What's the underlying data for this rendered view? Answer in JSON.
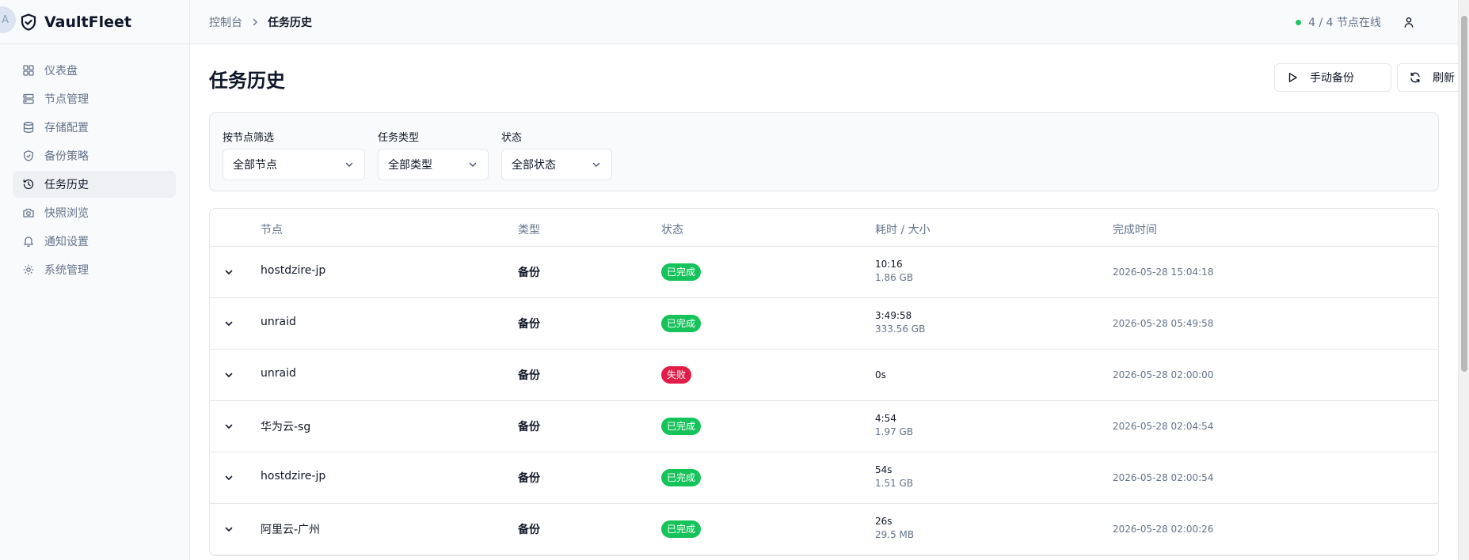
{
  "brand": {
    "avatar_letter": "A",
    "name": "VaultFleet"
  },
  "sidebar": {
    "items": [
      {
        "label": "仪表盘",
        "icon": "dashboard-icon",
        "active": false
      },
      {
        "label": "节点管理",
        "icon": "server-icon",
        "active": false
      },
      {
        "label": "存储配置",
        "icon": "database-icon",
        "active": false
      },
      {
        "label": "备份策略",
        "icon": "shield-check-icon",
        "active": false
      },
      {
        "label": "任务历史",
        "icon": "history-icon",
        "active": true
      },
      {
        "label": "快照浏览",
        "icon": "camera-icon",
        "active": false
      },
      {
        "label": "通知设置",
        "icon": "bell-icon",
        "active": false
      },
      {
        "label": "系统管理",
        "icon": "gear-icon",
        "active": false
      }
    ]
  },
  "header": {
    "breadcrumb": [
      "控制台",
      "任务历史"
    ],
    "node_status": "4 / 4 节点在线",
    "status_color": "#22c55e"
  },
  "page": {
    "title": "任务历史",
    "manual_backup_label": "手动备份",
    "refresh_label": "刷新"
  },
  "filters": {
    "node": {
      "label": "按节点筛选",
      "value": "全部节点"
    },
    "type": {
      "label": "任务类型",
      "value": "全部类型"
    },
    "status": {
      "label": "状态",
      "value": "全部状态"
    }
  },
  "table": {
    "columns": [
      "节点",
      "类型",
      "状态",
      "耗时 / 大小",
      "完成时间"
    ],
    "status_colors": {
      "已完成": "#16c35a",
      "失败": "#e11d48"
    },
    "rows": [
      {
        "node": "hostdzire-jp",
        "type": "备份",
        "status": "已完成",
        "duration": "10:16",
        "size": "1.86 GB",
        "finished": "2026-05-28 15:04:18"
      },
      {
        "node": "unraid",
        "type": "备份",
        "status": "已完成",
        "duration": "3:49:58",
        "size": "333.56 GB",
        "finished": "2026-05-28 05:49:58"
      },
      {
        "node": "unraid",
        "type": "备份",
        "status": "失败",
        "duration": "0s",
        "size": "",
        "finished": "2026-05-28 02:00:00"
      },
      {
        "node": "华为云-sg",
        "type": "备份",
        "status": "已完成",
        "duration": "4:54",
        "size": "1.97 GB",
        "finished": "2026-05-28 02:04:54"
      },
      {
        "node": "hostdzire-jp",
        "type": "备份",
        "status": "已完成",
        "duration": "54s",
        "size": "1.51 GB",
        "finished": "2026-05-28 02:00:54"
      },
      {
        "node": "阿里云-广州",
        "type": "备份",
        "status": "已完成",
        "duration": "26s",
        "size": "29.5 MB",
        "finished": "2026-05-28 02:00:26"
      }
    ]
  }
}
